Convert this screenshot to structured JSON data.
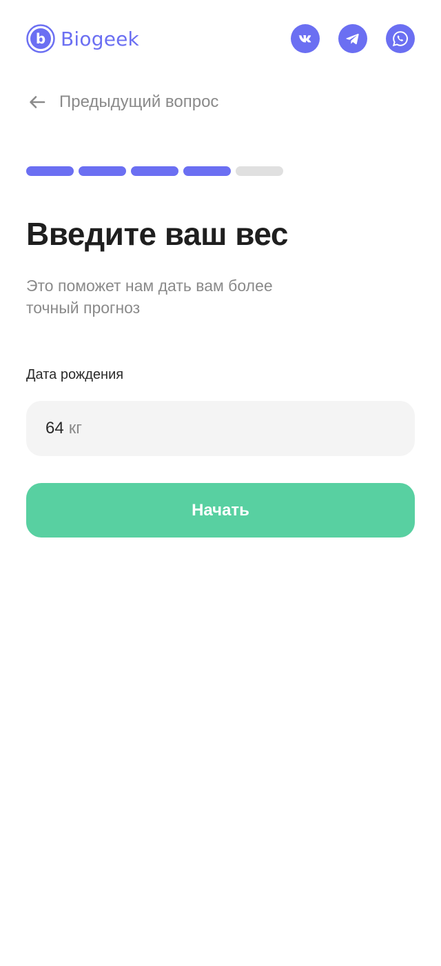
{
  "brand": {
    "name": "Biogeek",
    "logo_letter": "b"
  },
  "socials": [
    {
      "icon": "vk-icon"
    },
    {
      "icon": "telegram-icon"
    },
    {
      "icon": "whatsapp-icon"
    }
  ],
  "navigation": {
    "back_label": "Предыдущий вопрос"
  },
  "progress": {
    "completed_steps": 4,
    "total_steps": 5
  },
  "question": {
    "title": "Введите ваш вес",
    "subtitle": "Это поможет нам дать вам более точный прогноз"
  },
  "form": {
    "field_label": "Дата рождения",
    "weight_value": "64",
    "weight_unit": "кг"
  },
  "actions": {
    "submit_label": "Начать"
  },
  "colors": {
    "accent": "#6b6ff2",
    "button": "#58d0a1",
    "track": "#e0e0e0",
    "field_bg": "#f4f4f4",
    "muted_text": "#8a8a8a"
  }
}
